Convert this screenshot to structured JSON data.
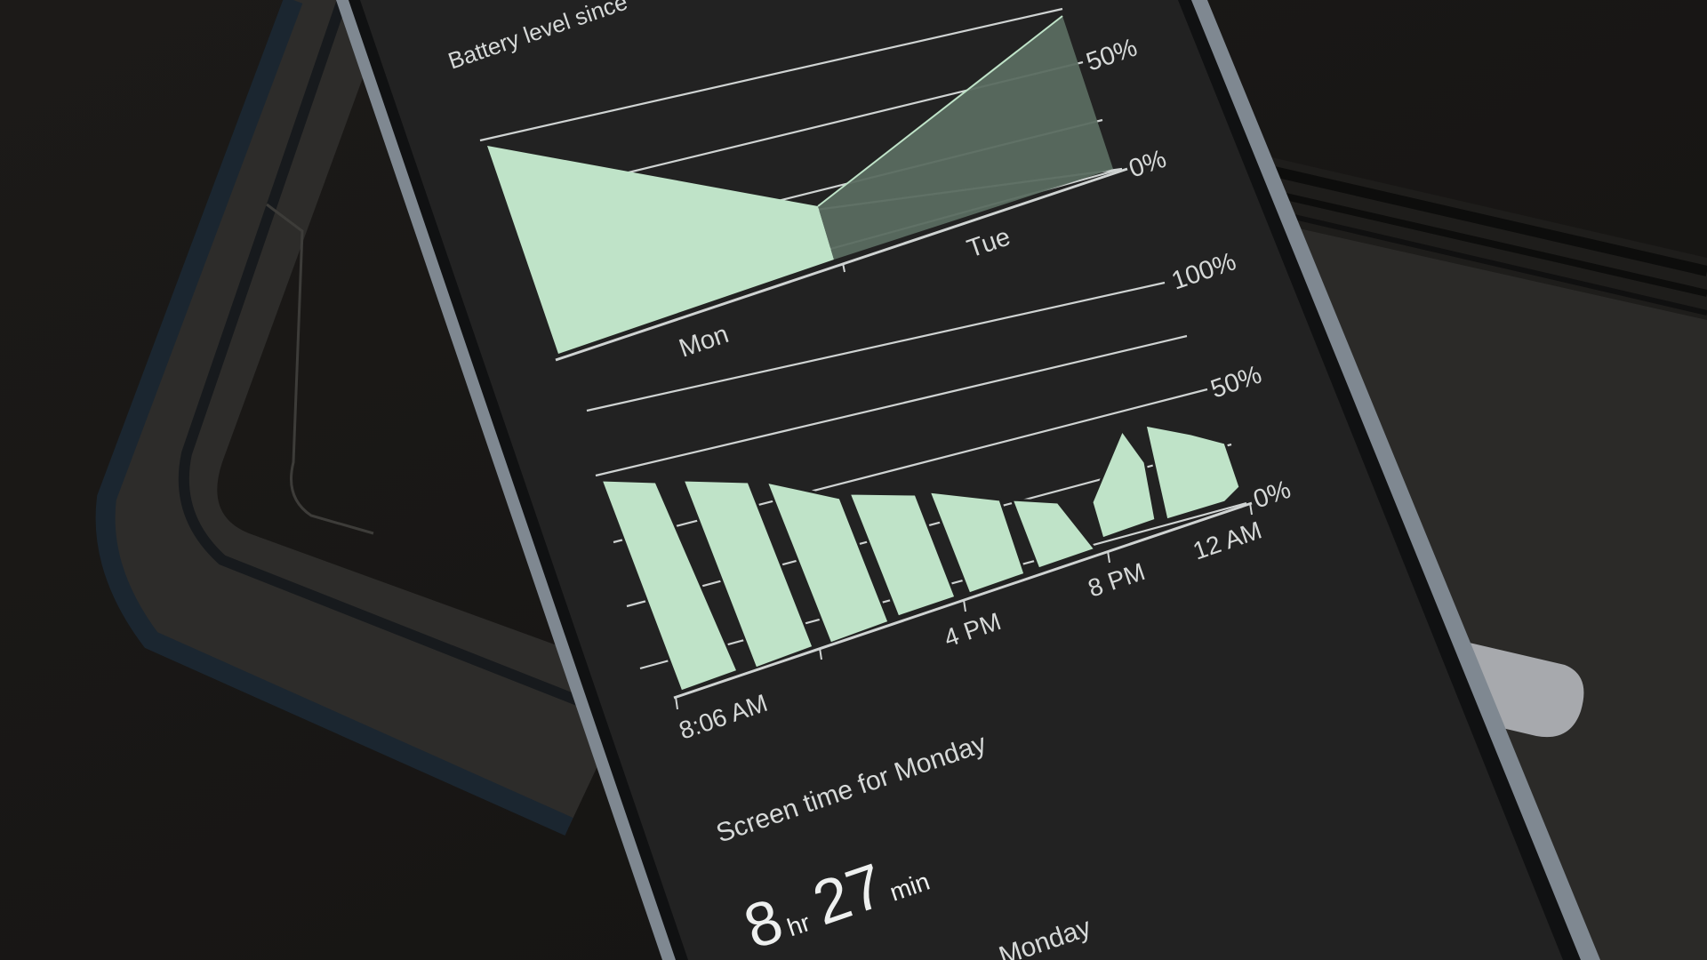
{
  "battery_section": {
    "heading": "Battery level since",
    "top_chart": {
      "tick_labels": [
        "50%",
        "0%"
      ],
      "day_labels": [
        "Mon",
        "Tue"
      ]
    },
    "bottom_chart": {
      "tick_labels": [
        "100%",
        "50%",
        "0%"
      ],
      "time_labels": [
        "8:06 AM",
        "4 PM",
        "8 PM",
        "12 AM"
      ]
    }
  },
  "screen_time": {
    "heading": "Screen time for Monday",
    "hours": "8",
    "hours_unit": "hr",
    "minutes": "27",
    "minutes_unit": "min",
    "partial_label": "Monday"
  },
  "colors": {
    "background": "#1a1816",
    "screen": "#222222",
    "bar_fill": "#bfe3c8",
    "projected_fill": "#5a6b60",
    "gridline": "#cfd3d2",
    "text": "#d6d9d8"
  }
}
